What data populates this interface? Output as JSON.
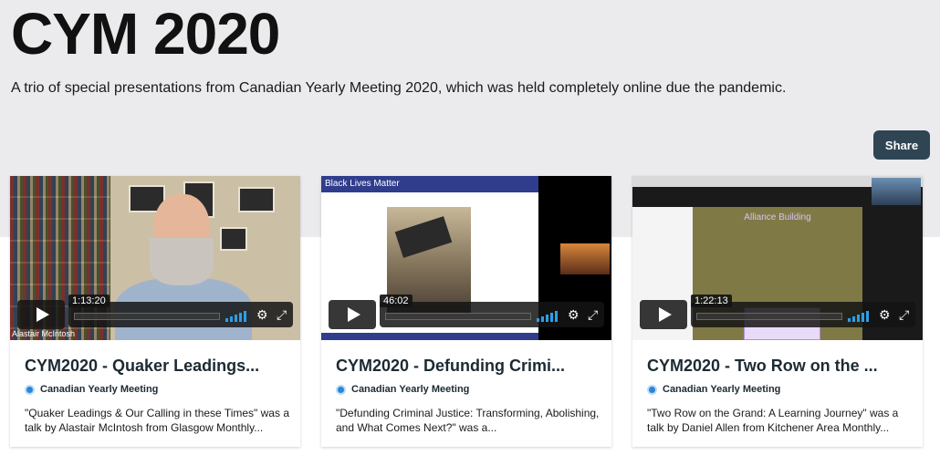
{
  "page": {
    "title": "CYM 2020",
    "description": "A trio of special presentations from Canadian Yearly Meeting 2020, which was held completely online due the pandemic.",
    "share_label": "Share"
  },
  "cards": [
    {
      "title": "CYM2020 - Quaker Leadings...",
      "channel": "Canadian Yearly Meeting",
      "description": "\"Quaker Leadings & Our Calling in these Times\" was a talk by Alastair McIntosh from Glasgow Monthly...",
      "duration": "1:13:20",
      "thumb_caption": "Alastair McIntosh"
    },
    {
      "title": "CYM2020 - Defunding Crimi...",
      "channel": "Canadian Yearly Meeting",
      "description": "\"Defunding Criminal Justice: Transforming, Abolishing, and What Comes Next?\" was a...",
      "duration": "46:02",
      "thumb_caption": "Black Lives Matter"
    },
    {
      "title": "CYM2020 - Two Row on the ...",
      "channel": "Canadian Yearly Meeting",
      "description": "\"Two Row on the Grand: A Learning Journey\" was a talk by Daniel Allen from Kitchener Area Monthly...",
      "duration": "1:22:13",
      "thumb_caption": "Alliance Building"
    }
  ],
  "colors": {
    "hero_bg": "#ebebed",
    "share_bg": "#2f4554",
    "accent_volume": "#2b9fe6"
  }
}
